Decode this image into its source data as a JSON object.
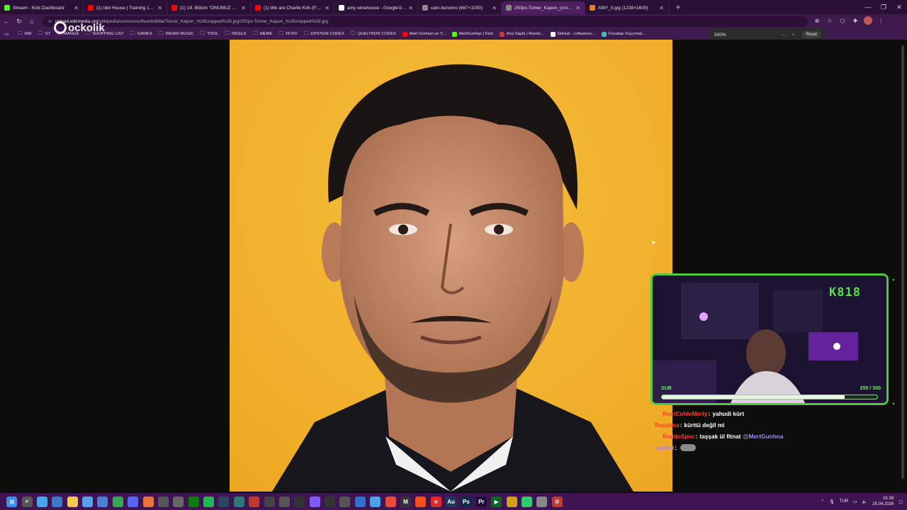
{
  "tabs": [
    {
      "title": "Stream - Kick Dashboard",
      "color": "#53fc18",
      "icon": "kick-icon",
      "active": false
    },
    {
      "title": "(1) Idol House | Training 14 | Glam",
      "color": "#ff0000",
      "icon": "youtube-icon",
      "active": false
    },
    {
      "title": "(1) 19. Bölüm \"ÖNÜMÜZ YAZ\" Pe",
      "color": "#ff0000",
      "icon": "youtube-icon",
      "active": false
    },
    {
      "title": "(1) We are Charlie Kirk (Phonk Ver",
      "color": "#ff0000",
      "icon": "youtube-icon",
      "active": false
    },
    {
      "title": "amy winehouse - Google'da Ara",
      "color": "#ffffff",
      "icon": "google-icon",
      "active": false
    },
    {
      "title": "cam-bonomo (667×1000)",
      "color": "#888888",
      "icon": "image-icon",
      "active": false
    },
    {
      "title": "250px-Tomer_Kapon_(cropped).jp",
      "color": "#888888",
      "icon": "image-icon",
      "active": true
    },
    {
      "title": "AMY_0.jpg (1238×1600)",
      "color": "#e67e22",
      "icon": "image-icon",
      "active": false
    }
  ],
  "address": {
    "host": "upload.wikimedia.org",
    "path": "/wikipedia/commons/thumb/8/8a/Tomer_Kapon_%28cropped%29.jpg/250px-Tomer_Kapon_%28cropped%29.jpg"
  },
  "logo_text": "ockolik",
  "bookmarks": [
    {
      "label": "DIR",
      "type": "folder"
    },
    {
      "label": "ST",
      "type": "folder"
    },
    {
      "label": "MANGA",
      "type": "folder"
    },
    {
      "label": "SHOPPING LIST",
      "type": "folder"
    },
    {
      "label": "GAMES",
      "type": "folder"
    },
    {
      "label": "WEIRD MUSIC",
      "type": "folder"
    },
    {
      "label": "TOOL",
      "type": "folder"
    },
    {
      "label": "İNCELE",
      "type": "folder"
    },
    {
      "label": "MEME",
      "type": "folder"
    },
    {
      "label": "FFXIV",
      "type": "folder"
    },
    {
      "label": "EPSTEIN CODEX",
      "type": "folder"
    },
    {
      "label": "QUELTRON CODEX",
      "type": "folder"
    },
    {
      "label": "Mert Günhan ve Y...",
      "type": "site",
      "color": "#ff0000"
    },
    {
      "label": "MertGunhan | Kick",
      "type": "site",
      "color": "#53fc18"
    },
    {
      "label": "Ana Sayfa | Resmi...",
      "type": "site",
      "color": "#e03030"
    },
    {
      "label": "GitHub - coltaeneo...",
      "type": "site",
      "color": "#ffffff"
    },
    {
      "label": "Fırsatları Kaçırmal...",
      "type": "site",
      "color": "#2ec4b6"
    }
  ],
  "zoom": {
    "level": "500%",
    "reset_label": "Reset"
  },
  "stream_overlay": {
    "goal_text": "K818",
    "sub_label": "SUB",
    "sub_count": "255 / 300",
    "sub_progress": 0.85
  },
  "chat": [
    {
      "user": "RustCohleMarty",
      "user_color": "#ff3b30",
      "text": "yahudi kürt",
      "badge": "sword-icon",
      "mention": ""
    },
    {
      "user": "Rasatma",
      "user_color": "#ff3b30",
      "text": "kürttü değil mi",
      "badge": "",
      "mention": ""
    },
    {
      "user": "ReddoSpec",
      "user_color": "#ff3b30",
      "text": "taşşak ül fitnat",
      "badge": "coin-icon",
      "mention": "@MertGunhna"
    },
    {
      "user": "seyfert",
      "user_color": "#b07cff",
      "text": "",
      "badge": "",
      "mention": "",
      "emote": "car-emote"
    }
  ],
  "tray": {
    "lang": "TUR",
    "time": "01:38",
    "date": "25.04.2026"
  },
  "colors": {
    "tabbar": "#2a1036",
    "toolbar": "#3c1a4c",
    "taskbar": "#3e1552",
    "accent_green": "#53c742",
    "photo_bg": "#f2b233"
  }
}
